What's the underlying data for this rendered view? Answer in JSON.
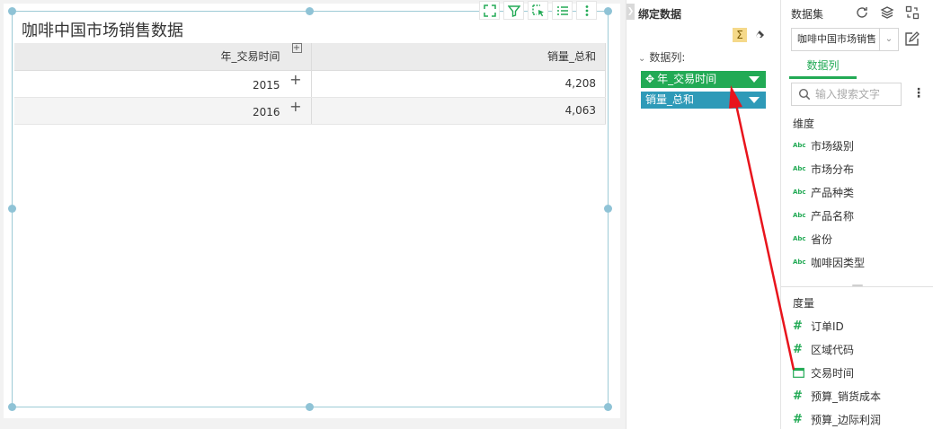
{
  "widget": {
    "title": "咖啡中国市场销售数据",
    "toolbar": [
      "fullscreen-icon",
      "filter-icon",
      "select-icon",
      "list-icon",
      "more-vertical-icon"
    ],
    "table": {
      "headers": [
        "年_交易时间",
        "销量_总和"
      ],
      "expand_symbol": "+",
      "rows": [
        {
          "year": "2015",
          "value": "4,208",
          "toggle": "+"
        },
        {
          "year": "2016",
          "value": "4,063",
          "toggle": "+"
        }
      ]
    }
  },
  "binding": {
    "title": "绑定数据",
    "sigma": "Σ",
    "columns_title": "数据列:",
    "chevron": "⌄",
    "pills": [
      {
        "label": "年_交易时间",
        "color": "#22aa55"
      },
      {
        "label": "销量_总和",
        "color": "#2e9ab8"
      }
    ]
  },
  "dataset": {
    "title": "数据集",
    "selected": "咖啡中国市场销售",
    "tab": "数据列",
    "search_placeholder": "输入搜索文字",
    "more": "⋮",
    "dimension_title": "维度",
    "dimension_type": "Abc",
    "dimensions": [
      "市场级别",
      "市场分布",
      "产品种类",
      "产品名称",
      "省份",
      "咖啡因类型"
    ],
    "measure_title": "度量",
    "measures": [
      {
        "label": "订单ID",
        "type": "hash"
      },
      {
        "label": "区域代码",
        "type": "hash"
      },
      {
        "label": "交易时间",
        "type": "calendar"
      },
      {
        "label": "预算_销货成本",
        "type": "hash"
      },
      {
        "label": "预算_边际利润",
        "type": "hash"
      }
    ]
  },
  "colors": {
    "accent": "#22aa55",
    "teal": "#2e9ab8",
    "annotation": "#e8141c",
    "selection": "#8fc3d6"
  }
}
